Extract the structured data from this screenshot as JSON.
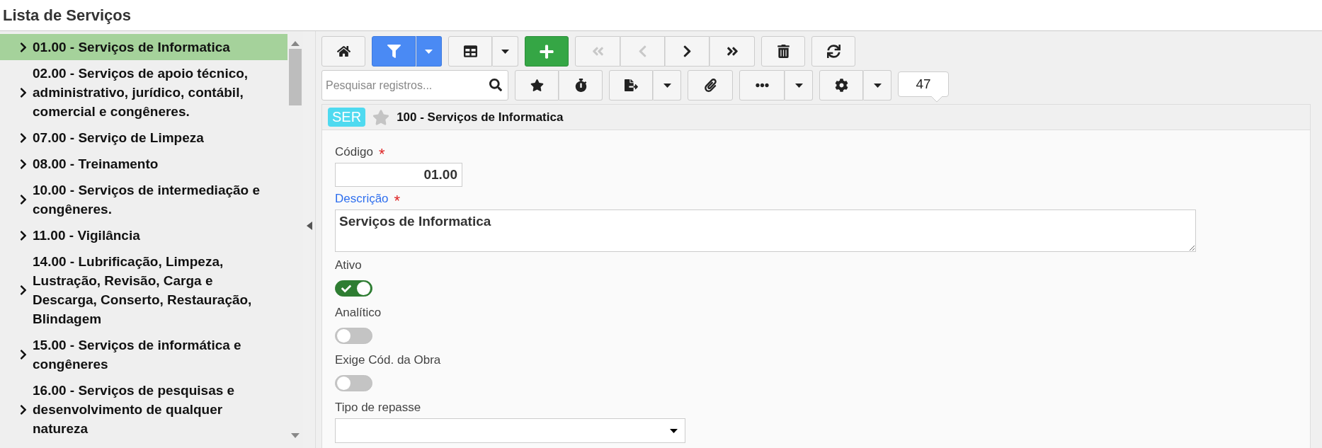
{
  "page_title": "Lista de Serviços",
  "sidebar": {
    "items": [
      {
        "label": "01.00 - Serviços de Informatica",
        "selected": true
      },
      {
        "label": "02.00 - Serviços de apoio técnico, administrativo, jurídico, contábil, comercial e congêneres.",
        "selected": false
      },
      {
        "label": "07.00 - Serviço de Limpeza",
        "selected": false
      },
      {
        "label": "08.00 - Treinamento",
        "selected": false
      },
      {
        "label": "10.00 - Serviços de intermediação e congêneres.",
        "selected": false
      },
      {
        "label": "11.00 - Vigilância",
        "selected": false
      },
      {
        "label": "14.00 - Lubrificação, Limpeza, Lustração, Revisão, Carga e Descarga, Conserto, Restauração, Blindagem",
        "selected": false
      },
      {
        "label": "15.00 - Serviços de informática e congêneres",
        "selected": false
      },
      {
        "label": "16.00 - Serviços de pesquisas e desenvolvimento de qualquer natureza",
        "selected": false
      }
    ]
  },
  "toolbar": {
    "filter_active": true,
    "navigation": [
      {
        "disabled": true
      },
      {
        "disabled": true
      },
      {
        "disabled": false
      },
      {
        "disabled": false
      }
    ],
    "search": {
      "placeholder": "Pesquisar registros..."
    },
    "record_count": "47"
  },
  "record": {
    "badge": "SER",
    "favorite": false,
    "title": "100 - Serviços de Informatica"
  },
  "form": {
    "fields": [
      {
        "kind": "text",
        "label": "Código",
        "required_mark": "*",
        "focused": false,
        "value": "01.00"
      },
      {
        "kind": "textarea",
        "label": "Descrição",
        "required_mark": "*",
        "focused": true,
        "value": "Serviços de Informatica"
      },
      {
        "kind": "toggle",
        "label": "Ativo",
        "on": true
      },
      {
        "kind": "toggle",
        "label": "Analítico",
        "on": false
      },
      {
        "kind": "toggle",
        "label": "Exige Cód. da Obra",
        "on": false
      },
      {
        "kind": "select",
        "label": "Tipo de repasse"
      }
    ]
  }
}
